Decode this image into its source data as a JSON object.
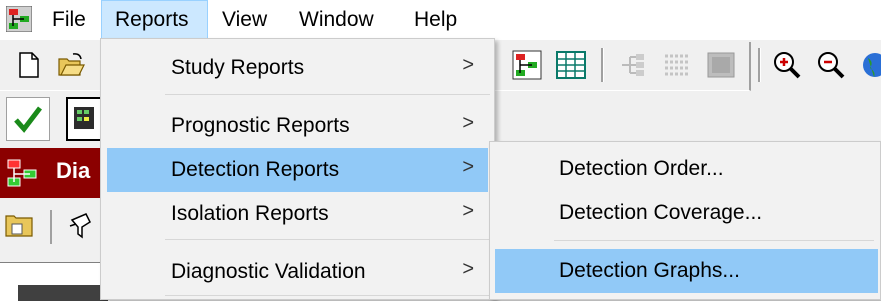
{
  "menubar": {
    "items": [
      {
        "label": "File"
      },
      {
        "label": "Reports"
      },
      {
        "label": "View"
      },
      {
        "label": "Window"
      },
      {
        "label": "Help"
      }
    ]
  },
  "panel": {
    "title_fragment": "Dia"
  },
  "reports_menu": {
    "items": [
      {
        "label": "Study Reports",
        "submenu_arrow": ">"
      },
      {
        "label": "Prognostic Reports",
        "submenu_arrow": ">"
      },
      {
        "label": "Detection Reports",
        "submenu_arrow": ">"
      },
      {
        "label": "Isolation Reports",
        "submenu_arrow": ">"
      },
      {
        "label": "Diagnostic Validation",
        "submenu_arrow": ">"
      }
    ]
  },
  "detection_submenu": {
    "items": [
      {
        "label": "Detection Order..."
      },
      {
        "label": "Detection Coverage..."
      },
      {
        "label": "Detection Graphs..."
      }
    ]
  },
  "colors": {
    "menu_highlight": "#91c9f7",
    "menubar_open": "#cce8ff",
    "panel_title_bg": "#8b0000"
  }
}
